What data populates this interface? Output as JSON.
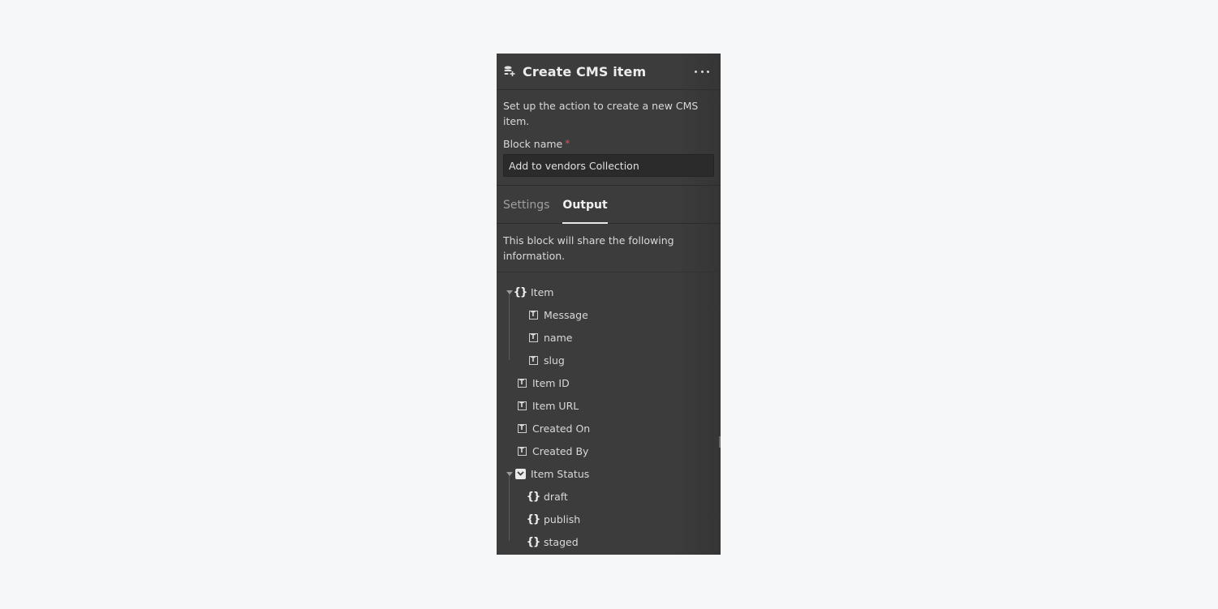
{
  "panel": {
    "title": "Create CMS item",
    "title_icon": "database-plus-icon",
    "more_icon": "more-horizontal-icon",
    "description": "Set up the action to create a new CMS item.",
    "block_name_label": "Block name",
    "required_marker": "*",
    "block_name_value": "Add to vendors Collection"
  },
  "tabs": [
    {
      "label": "Settings",
      "active": false
    },
    {
      "label": "Output",
      "active": true
    }
  ],
  "output": {
    "description": "This block will share the following information.",
    "tree": [
      {
        "label": "Item",
        "icon": "object-braces-icon",
        "expanded": true,
        "children": [
          {
            "label": "Message",
            "icon": "text-field-icon"
          },
          {
            "label": "name",
            "icon": "text-field-icon"
          },
          {
            "label": "slug",
            "icon": "text-field-icon"
          }
        ]
      },
      {
        "label": "Item ID",
        "icon": "text-field-icon"
      },
      {
        "label": "Item URL",
        "icon": "text-field-icon"
      },
      {
        "label": "Created On",
        "icon": "text-field-icon"
      },
      {
        "label": "Created By",
        "icon": "text-field-icon"
      },
      {
        "label": "Item Status",
        "icon": "option-dropdown-icon",
        "expanded": true,
        "children": [
          {
            "label": "draft",
            "icon": "object-braces-icon"
          },
          {
            "label": "publish",
            "icon": "object-braces-icon"
          },
          {
            "label": "staged",
            "icon": "object-braces-icon"
          }
        ]
      }
    ]
  },
  "colors": {
    "panel_bg": "#3c3c3c",
    "page_bg": "#f6f7f9",
    "required": "#e74b4b"
  }
}
